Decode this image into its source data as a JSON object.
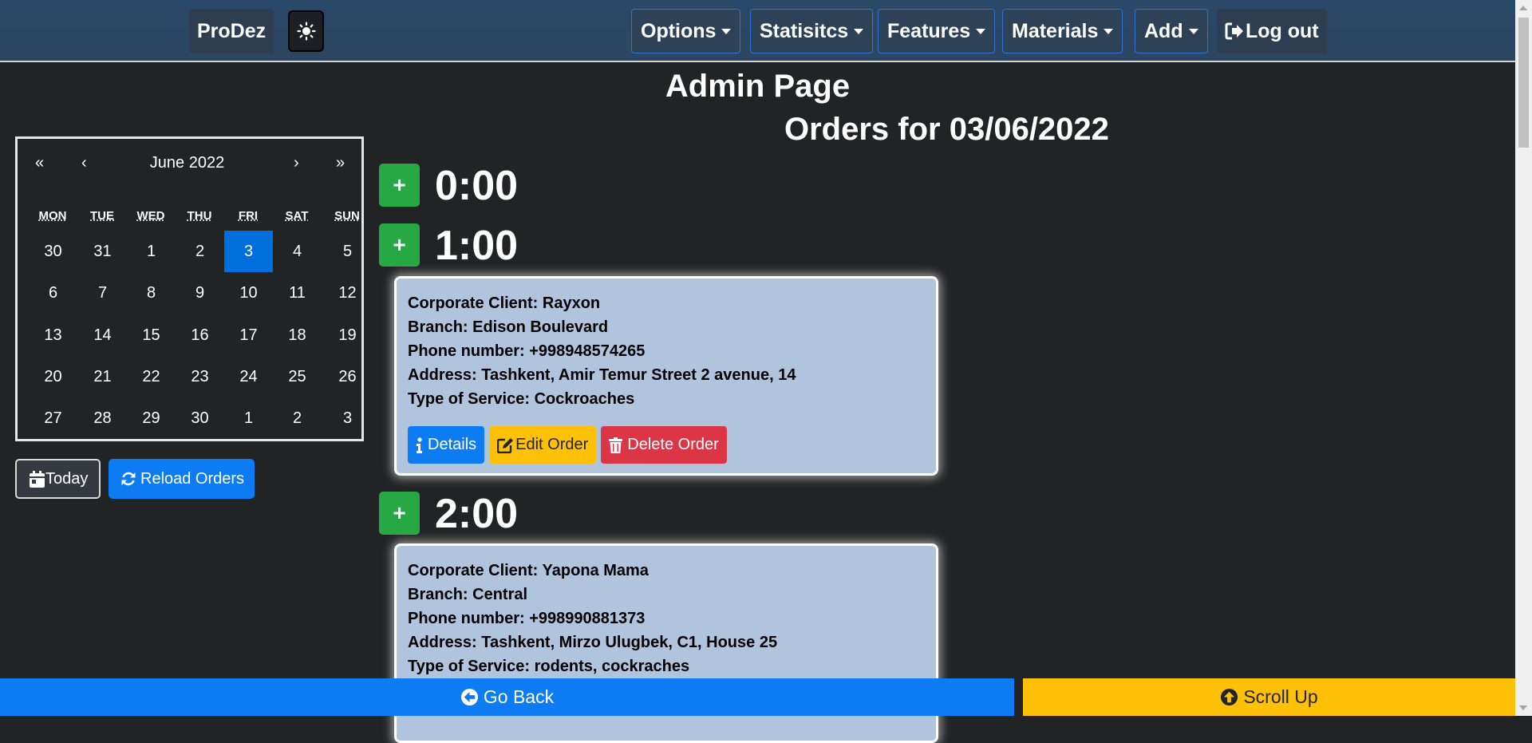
{
  "navbar": {
    "brand": "ProDez",
    "theme_icon": "sun-icon",
    "menus": [
      "Options",
      "Statisitcs",
      "Features",
      "Materials",
      "Add"
    ],
    "logout": "Log out"
  },
  "page": {
    "title": "Admin Page",
    "orders_heading": "Orders for 03/06/2022"
  },
  "calendar": {
    "month_label": "June 2022",
    "prev_year": "«",
    "prev_month": "‹",
    "next_month": "›",
    "next_year": "»",
    "weekdays": [
      "MON",
      "TUE",
      "WED",
      "THU",
      "FRI",
      "SAT",
      "SUN"
    ],
    "weeks": [
      [
        "30",
        "31",
        "1",
        "2",
        "3",
        "4",
        "5"
      ],
      [
        "6",
        "7",
        "8",
        "9",
        "10",
        "11",
        "12"
      ],
      [
        "13",
        "14",
        "15",
        "16",
        "17",
        "18",
        "19"
      ],
      [
        "20",
        "21",
        "22",
        "23",
        "24",
        "25",
        "26"
      ],
      [
        "27",
        "28",
        "29",
        "30",
        "1",
        "2",
        "3"
      ]
    ],
    "selected_day": "3",
    "today_label": "Today",
    "reload_label": "Reload Orders"
  },
  "schedule": {
    "add_label": "+",
    "slots": [
      {
        "hour": "0:00",
        "orders": []
      },
      {
        "hour": "1:00",
        "orders": [
          {
            "lines": [
              "Corporate Client: Rayxon",
              "Branch: Edison Boulevard",
              "Phone number: +998948574265",
              "Address: Tashkent, Amir Temur Street 2 avenue, 14",
              "Type of Service: Cockroaches"
            ]
          }
        ]
      },
      {
        "hour": "2:00",
        "orders": [
          {
            "lines": [
              "Corporate Client: Yapona Mama",
              "Branch: Central",
              "Phone number: +998990881373",
              "Address: Tashkent, Mirzo Ulugbek, C1, House 25",
              "Type of Service: rodents, cockraches"
            ]
          }
        ]
      }
    ],
    "actions": {
      "details": "Details",
      "edit": "Edit Order",
      "delete": "Delete Order"
    }
  },
  "footer": {
    "go_back": "Go Back",
    "scroll_up": "Scroll Up"
  },
  "colors": {
    "navbar": "#2a4868",
    "success": "#28a745",
    "primary": "#0d7cf2",
    "warning": "#ffc107",
    "danger": "#dc3545",
    "card": "#b0c4de"
  }
}
